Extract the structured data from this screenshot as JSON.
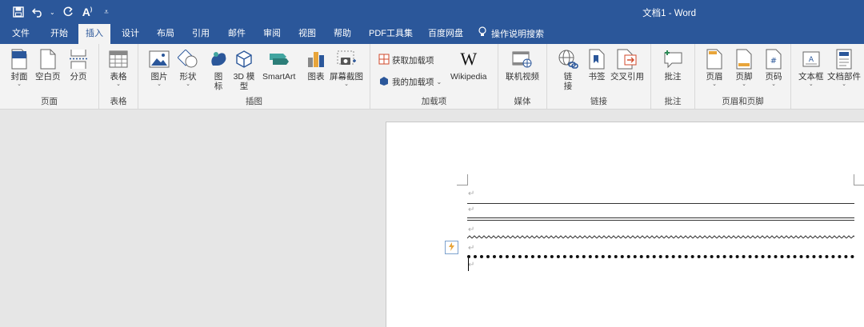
{
  "title_bar": {
    "document_title": "文档1  -  Word",
    "qat": [
      "save-icon",
      "undo-icon",
      "redo-icon",
      "font-size-icon",
      "customize-qat-icon"
    ]
  },
  "tabs": [
    {
      "label": "文件"
    },
    {
      "label": "开始"
    },
    {
      "label": "插入",
      "active": true
    },
    {
      "label": "设计"
    },
    {
      "label": "布局"
    },
    {
      "label": "引用"
    },
    {
      "label": "邮件"
    },
    {
      "label": "审阅"
    },
    {
      "label": "视图"
    },
    {
      "label": "帮助"
    },
    {
      "label": "PDF工具集"
    },
    {
      "label": "百度网盘"
    }
  ],
  "tell_me": {
    "label": "操作说明搜索"
  },
  "ribbon": {
    "pages": {
      "label": "页面",
      "cover": "封面",
      "blank": "空白页",
      "break": "分页"
    },
    "tables": {
      "label": "表格",
      "table": "表格"
    },
    "illustrations": {
      "label": "插图",
      "picture": "图片",
      "shapes": "形状",
      "icons": "图\n标",
      "model3d": "3D 模\n型",
      "smartart": "SmartArt",
      "chart": "图表",
      "screenshot": "屏幕截图"
    },
    "addins": {
      "label": "加载项",
      "get": "获取加载项",
      "my": "我的加载项",
      "wiki": "Wikipedia"
    },
    "media": {
      "label": "媒体",
      "video": "联机视频"
    },
    "links": {
      "label": "链接",
      "link": "链\n接",
      "bookmark": "书签",
      "xref": "交叉引用"
    },
    "comments": {
      "label": "批注",
      "comment": "批注"
    },
    "headerfooter": {
      "label": "页眉和页脚",
      "header": "页眉",
      "footer": "页脚",
      "pagenum": "页码"
    },
    "text": {
      "textbox": "文本框",
      "docparts": "文档部件"
    }
  },
  "document": {
    "paragraph_mark": "↵"
  }
}
